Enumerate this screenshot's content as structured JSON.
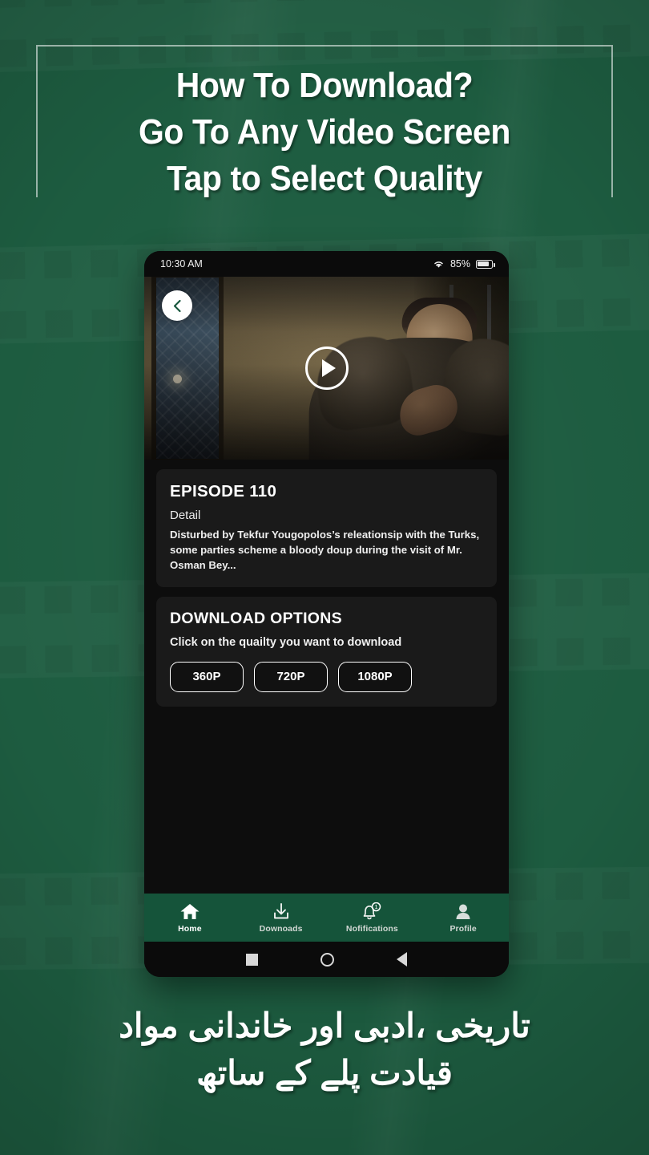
{
  "promo": {
    "headline_lines": [
      "How To Download?",
      "Go To Any Video Screen",
      "Tap to Select Quality"
    ],
    "caption_lines": [
      "تاریخی ،ادبی اور خاندانی مواد",
      "قیادت پلے کے ساتھ"
    ],
    "background_color": "#1d5c40",
    "accent_color": "#15543a"
  },
  "phone": {
    "status_bar": {
      "time": "10:30 AM",
      "wifi_icon": "wifi-icon",
      "battery_percent": "85%",
      "battery_icon": "battery-icon"
    },
    "video_player": {
      "back_icon": "chevron-left-icon",
      "play_icon": "play-icon"
    },
    "episode_card": {
      "title": "EPISODE 110",
      "subtitle": "Detail",
      "description": "Disturbed by Tekfur Yougopolos’s releationsip with the Turks, some parties scheme a bloody doup during the visit of Mr. Osman Bey..."
    },
    "download_card": {
      "title": "DOWNLOAD OPTIONS",
      "subtitle": "Click on the quailty you want to download",
      "options": [
        {
          "label": "360P"
        },
        {
          "label": "720P"
        },
        {
          "label": "1080P"
        }
      ]
    },
    "app_nav": [
      {
        "label": "Home",
        "icon": "home-icon",
        "active": true,
        "badge": ""
      },
      {
        "label": "Downoads",
        "icon": "download-icon",
        "active": false,
        "badge": ""
      },
      {
        "label": "Nofifications",
        "icon": "bell-icon",
        "active": false,
        "badge": "1"
      },
      {
        "label": "Profile",
        "icon": "person-icon",
        "active": false,
        "badge": ""
      }
    ],
    "system_nav": [
      {
        "icon": "recents-square-icon"
      },
      {
        "icon": "home-circle-icon"
      },
      {
        "icon": "back-triangle-icon"
      }
    ]
  }
}
